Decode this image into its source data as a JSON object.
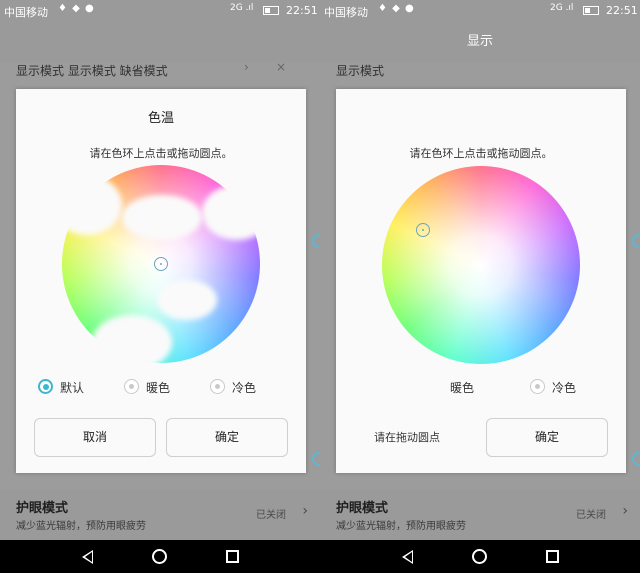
{
  "status_bar": {
    "carrier": "中国移动",
    "notif": "♦ ◆ ●",
    "signal": "2G .ıl",
    "time": "22:51"
  },
  "left": {
    "background_row": "显示模式 显示模式 缺省模式",
    "dialog": {
      "title": "色温",
      "hint": "请在色环上点击或拖动圆点。",
      "options": [
        "默认",
        "暖色",
        "冷色"
      ],
      "selected_option": "默认",
      "cancel_label": "取消",
      "confirm_label": "确定"
    },
    "eye_protection": {
      "title": "护眼模式",
      "subtitle": "减少蓝光辐射，预防用眼疲劳",
      "state": "已关闭"
    }
  },
  "right": {
    "header_title": "显示",
    "background_row": "显示模式",
    "dialog": {
      "hint": "请在色环上点击或拖动圆点。",
      "options": [
        "暖色",
        "冷色"
      ],
      "overlay_text": "请在拖动圆点",
      "confirm_label": "确定"
    },
    "eye_protection": {
      "title": "护眼模式",
      "subtitle": "减少蓝光辐射，预防用眼疲劳",
      "state": "已关闭"
    }
  },
  "colors": {
    "accent": "#3bb8cf",
    "status_bar": "#9a9a9a",
    "nav_bar": "#000000"
  }
}
